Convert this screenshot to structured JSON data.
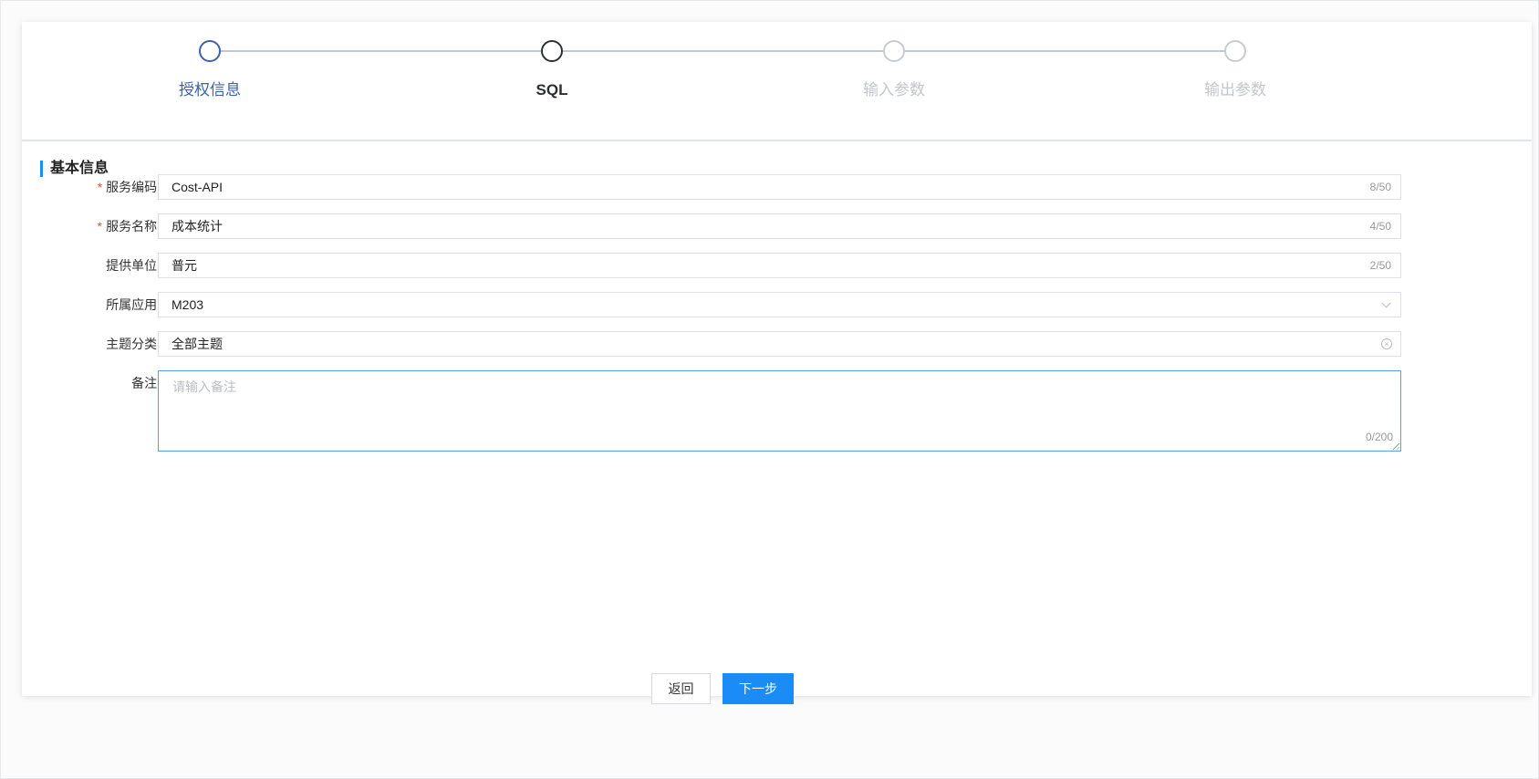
{
  "steps": [
    {
      "label": "授权信息",
      "state": "done"
    },
    {
      "label": "SQL",
      "state": "active"
    },
    {
      "label": "输入参数",
      "state": "pending"
    },
    {
      "label": "输出参数",
      "state": "pending"
    }
  ],
  "section": {
    "title": "基本信息"
  },
  "form": {
    "service_code": {
      "label": "服务编码:",
      "required_mark": "*",
      "value": "Cost-API",
      "counter": "8/50"
    },
    "service_name": {
      "label": "服务名称:",
      "required_mark": "*",
      "value": "成本统计",
      "counter": "4/50"
    },
    "provider": {
      "label": "提供单位:",
      "value": "普元",
      "counter": "2/50"
    },
    "application": {
      "label": "所属应用:",
      "value": "M203"
    },
    "topic": {
      "label": "主题分类:",
      "value": "全部主题"
    },
    "remark": {
      "label": "备注:",
      "placeholder": "请输入备注",
      "counter": "0/200"
    }
  },
  "buttons": {
    "back": "返回",
    "next": "下一步"
  },
  "colors": {
    "accent": "#1b8cf6",
    "done_step": "#3d62a8",
    "required": "#e74c3c"
  }
}
